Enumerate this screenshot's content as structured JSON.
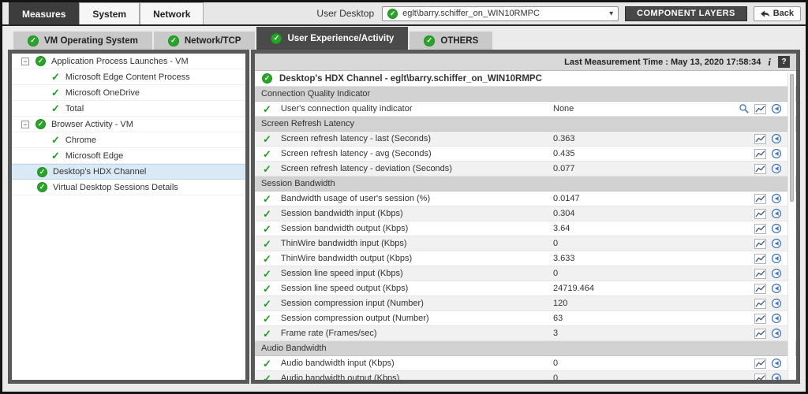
{
  "icons": {
    "check": "✓",
    "minus": "−",
    "chevron": "▾",
    "info": "i",
    "help": "?"
  },
  "colors": {
    "green": "#28a428",
    "dark_button": "#484848",
    "section_bg": "#d2d2d2",
    "selected_row": "#d9eaf6",
    "icon_blue": "#4a7ab5"
  },
  "top_bar": {
    "tabs": [
      {
        "label": "Measures",
        "active": true
      },
      {
        "label": "System",
        "active": false
      },
      {
        "label": "Network",
        "active": false
      }
    ],
    "user_desktop_label": "User Desktop",
    "desktop_selector": {
      "value": "eglt\\barry.schiffer_on_WIN10RMPC"
    },
    "component_layers_label": "COMPONENT LAYERS",
    "back_label": "Back"
  },
  "layer_tabs": [
    {
      "label": "VM Operating System",
      "active": false
    },
    {
      "label": "Network/TCP",
      "active": false
    },
    {
      "label": "User Experience/Activity",
      "active": true
    },
    {
      "label": "OTHERS",
      "active": false
    }
  ],
  "tree": [
    {
      "label": "Application Process Launches - VM",
      "level": 0,
      "expandable": true,
      "selected": false
    },
    {
      "label": "Microsoft Edge Content Process",
      "level": 1,
      "expandable": false,
      "selected": false
    },
    {
      "label": "Microsoft OneDrive",
      "level": 1,
      "expandable": false,
      "selected": false
    },
    {
      "label": "Total",
      "level": 1,
      "expandable": false,
      "selected": false
    },
    {
      "label": "Browser Activity - VM",
      "level": 0,
      "expandable": true,
      "selected": false
    },
    {
      "label": "Chrome",
      "level": 1,
      "expandable": false,
      "selected": false
    },
    {
      "label": "Microsoft Edge",
      "level": 1,
      "expandable": false,
      "selected": false
    },
    {
      "label": "Desktop's HDX Channel",
      "level": 0,
      "expandable": false,
      "selected": true
    },
    {
      "label": "Virtual Desktop Sessions Details",
      "level": 0,
      "expandable": false,
      "selected": false
    }
  ],
  "panel": {
    "last_measurement": "Last Measurement Time : May 13, 2020 17:58:34",
    "title": "Desktop's HDX Channel - eglt\\barry.schiffer_on_WIN10RMPC",
    "rows": [
      {
        "type": "section",
        "label": "Connection Quality Indicator"
      },
      {
        "type": "measure",
        "label": "User's connection quality indicator",
        "value": "None",
        "search": true
      },
      {
        "type": "section",
        "label": "Screen Refresh Latency"
      },
      {
        "type": "measure",
        "label": "Screen refresh latency - last (Seconds)",
        "value": "0.363"
      },
      {
        "type": "measure",
        "label": "Screen refresh latency - avg (Seconds)",
        "value": "0.435"
      },
      {
        "type": "measure",
        "label": "Screen refresh latency - deviation (Seconds)",
        "value": "0.077"
      },
      {
        "type": "section",
        "label": "Session Bandwidth"
      },
      {
        "type": "measure",
        "label": "Bandwidth usage of user's session (%)",
        "value": "0.0147"
      },
      {
        "type": "measure",
        "label": "Session bandwidth input (Kbps)",
        "value": "0.304"
      },
      {
        "type": "measure",
        "label": "Session bandwidth output (Kbps)",
        "value": "3.64"
      },
      {
        "type": "measure",
        "label": "ThinWire bandwidth input (Kbps)",
        "value": "0"
      },
      {
        "type": "measure",
        "label": "ThinWire bandwidth output (Kbps)",
        "value": "3.633"
      },
      {
        "type": "measure",
        "label": "Session line speed input (Kbps)",
        "value": "0"
      },
      {
        "type": "measure",
        "label": "Session line speed output (Kbps)",
        "value": "24719.464"
      },
      {
        "type": "measure",
        "label": "Session compression input (Number)",
        "value": "120"
      },
      {
        "type": "measure",
        "label": "Session compression output (Number)",
        "value": "63"
      },
      {
        "type": "measure",
        "label": "Frame rate (Frames/sec)",
        "value": "3"
      },
      {
        "type": "section",
        "label": "Audio Bandwidth"
      },
      {
        "type": "measure",
        "label": "Audio bandwidth input (Kbps)",
        "value": "0"
      },
      {
        "type": "measure",
        "label": "Audio bandwidth output (Kbps)",
        "value": "0"
      }
    ]
  }
}
